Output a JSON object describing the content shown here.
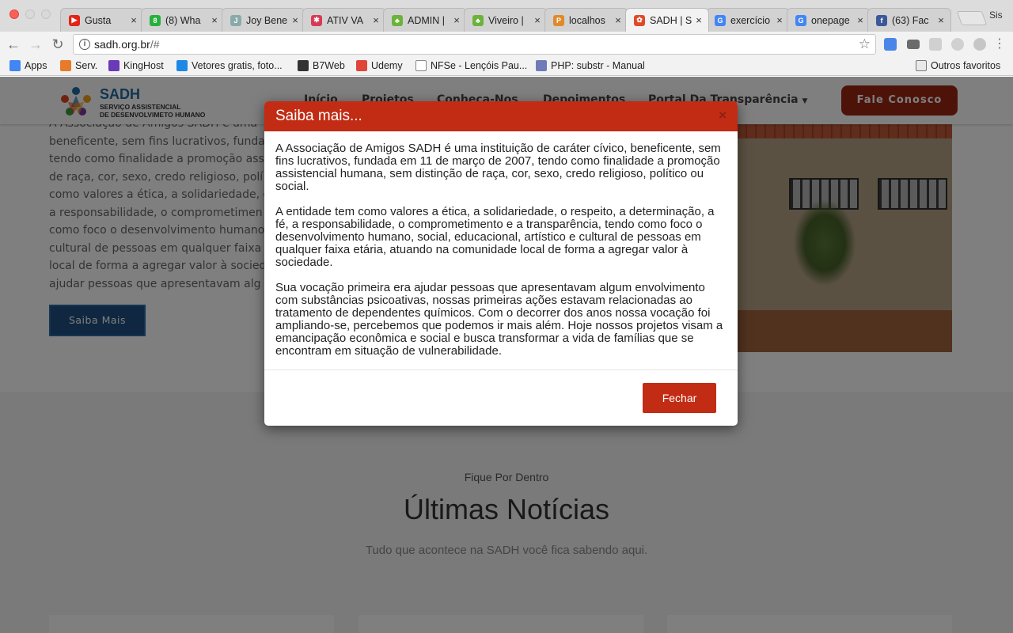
{
  "browser": {
    "tabs": [
      {
        "title": "Gusta",
        "icon": "youtube-icon",
        "color": "#e62117",
        "glyph": "▶",
        "active": false
      },
      {
        "title": "(8) Wha",
        "icon": "whatsapp-icon",
        "color": "#25b03a",
        "glyph": "8",
        "active": false
      },
      {
        "title": "Joy Bene",
        "icon": "joy-icon",
        "color": "#8aa",
        "glyph": "J",
        "active": false
      },
      {
        "title": "ATIV VA",
        "icon": "star-icon",
        "color": "#d83a55",
        "glyph": "✱",
        "active": false
      },
      {
        "title": "ADMIN |",
        "icon": "leaf-icon",
        "color": "#6bb33a",
        "glyph": "♣",
        "active": false
      },
      {
        "title": "Viveiro |",
        "icon": "leaf-icon",
        "color": "#6bb33a",
        "glyph": "♣",
        "active": false
      },
      {
        "title": "localhos",
        "icon": "phpmyadmin-icon",
        "color": "#e08a2a",
        "glyph": "P",
        "active": false
      },
      {
        "title": "SADH | S",
        "icon": "sadh-icon",
        "color": "#e04a2a",
        "glyph": "✿",
        "active": true
      },
      {
        "title": "exercício",
        "icon": "google-icon",
        "color": "#4285f4",
        "glyph": "G",
        "active": false
      },
      {
        "title": "onepage",
        "icon": "google-icon",
        "color": "#4285f4",
        "glyph": "G",
        "active": false
      },
      {
        "title": "(63) Fac",
        "icon": "facebook-icon",
        "color": "#3b5998",
        "glyph": "f",
        "active": false
      }
    ],
    "profile_label": "Sis",
    "url_host": "sadh.org.br",
    "url_path": "/#",
    "bookmarks": [
      {
        "label": "Apps",
        "icon": "apps-icon",
        "color": "#4285f4"
      },
      {
        "label": "Serv.",
        "icon": "cloud-icon",
        "color": "#e87a2a"
      },
      {
        "label": "KingHost",
        "icon": "kinghost-icon",
        "color": "#6a3ab8"
      },
      {
        "label": "Vetores gratis, foto...",
        "icon": "freepik-icon",
        "color": "#1e88e5"
      },
      {
        "label": "B7Web",
        "icon": "b7web-icon",
        "color": "#333333"
      },
      {
        "label": "Udemy",
        "icon": "udemy-icon",
        "color": "#e0453a"
      },
      {
        "label": "NFSe - Lençóis Pau...",
        "icon": "document-icon",
        "color": "#ffffff"
      },
      {
        "label": "PHP: substr - Manual",
        "icon": "php-icon",
        "color": "#6e7bb8"
      }
    ],
    "other_bookmarks": "Outros favoritos"
  },
  "site": {
    "logo_title": "SADH",
    "logo_sub_1": "SERVIÇO ASSISTENCIAL",
    "logo_sub_2": "DE DESENVOLVIMETO HUMANO",
    "menu": [
      "Início",
      "Projetos",
      "Conheça-Nos",
      "Depoimentos",
      "Portal Da Transparência"
    ],
    "cta": "Fale Conosco",
    "about_lines": [
      "A Associação de Amigos SADH é uma",
      "beneficente, sem fins lucrativos, funda",
      "tendo como finalidade a promoção ass",
      "de raça, cor, sexo, credo religioso, polí",
      "como valores a ética, a solidariedade, o",
      "a responsabilidade, o comprometimen",
      "como foco o desenvolvimento humano",
      "cultural de pessoas em qualquer faixa",
      "local de forma a agregar valor à socied",
      "ajudar pessoas que apresentavam alg"
    ],
    "saiba_button": "Saiba Mais",
    "news_kicker": "Fique Por Dentro",
    "news_title": "Últimas Notícias",
    "news_sub": "Tudo que acontece na SADH você fica sabendo aqui."
  },
  "modal": {
    "title": "Saiba mais...",
    "close_glyph": "×",
    "paragraphs": [
      "A Associação de Amigos SADH é uma instituição de caráter cívico, beneficente, sem fins lucrativos, fundada em 11 de março de 2007, tendo como finalidade a promoção assistencial humana, sem distinção de raça, cor, sexo, credo religioso, político ou social.",
      "A entidade tem como valores a ética, a solidariedade, o respeito, a determinação, a fé, a responsabilidade, o comprometimento e a transparência, tendo como foco o desenvolvimento humano, social, educacional, artístico e cultural de pessoas em qualquer faixa etária, atuando na comunidade local de forma a agregar valor à sociedade.",
      "Sua vocação primeira era ajudar pessoas que apresentavam algum envolvimento com substâncias psicoativas, nossas primeiras ações estavam relacionadas ao tratamento de dependentes químicos. Com o decorrer dos anos nossa vocação foi ampliando-se, percebemos que podemos ir mais além. Hoje nossos projetos visam a emancipação econômica e social e busca transformar a vida de famílias que se encontram em situação de vulnerabilidade."
    ],
    "close_button": "Fechar"
  },
  "colors": {
    "accent_red": "#c22c14",
    "cta_red": "#9b2712",
    "brand_blue": "#1e4f80"
  }
}
